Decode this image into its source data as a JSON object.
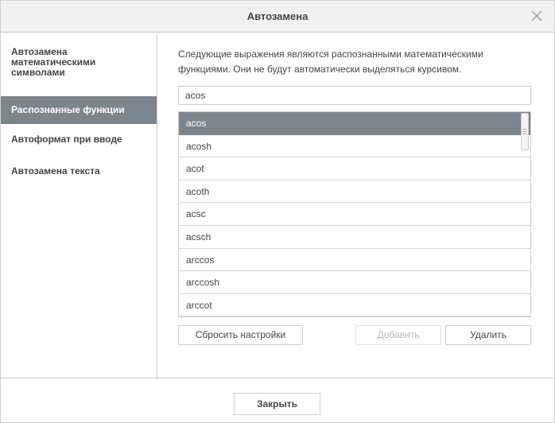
{
  "dialog": {
    "title": "Автозамена"
  },
  "sidebar": {
    "items": [
      {
        "label": "Автозамена математическими символами",
        "active": false
      },
      {
        "label": "Распознанные функции",
        "active": true
      },
      {
        "label": "Автоформат при вводе",
        "active": false
      },
      {
        "label": "Автозамена текста",
        "active": false
      }
    ]
  },
  "main": {
    "description": "Следующие выражения являются распознанными математическими функциями. Они не будут автоматически выделяться курсивом.",
    "input_value": "acos",
    "functions": [
      "acos",
      "acosh",
      "acot",
      "acoth",
      "acsc",
      "acsch",
      "arccos",
      "arccosh",
      "arccot"
    ],
    "selected_index": 0,
    "buttons": {
      "reset": "Сбросить настройки",
      "add": "Добавить",
      "delete": "Удалить"
    }
  },
  "footer": {
    "close": "Закрыть"
  },
  "colors": {
    "accent": "#7d858c",
    "border": "#cfcfcf",
    "titlebar": "#f1f1f1"
  }
}
